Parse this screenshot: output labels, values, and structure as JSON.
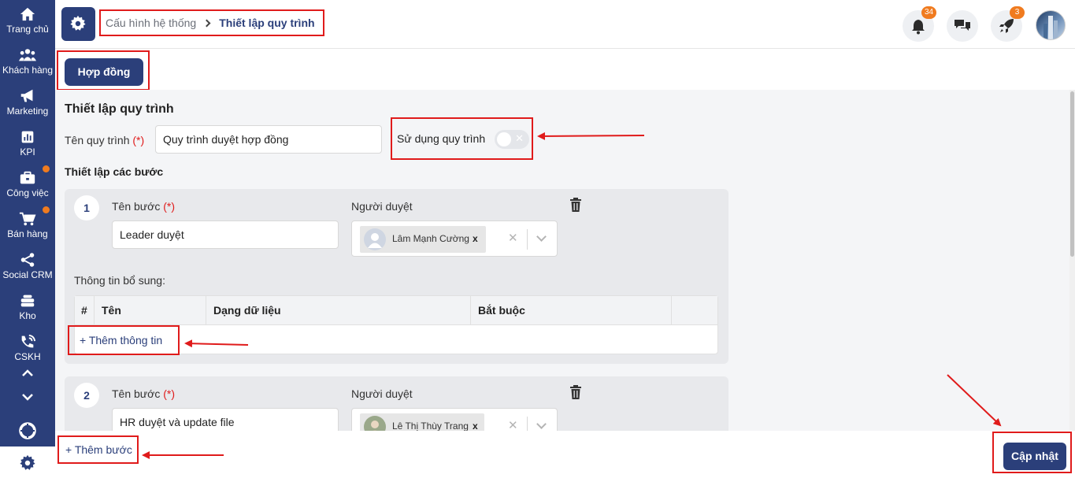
{
  "sidebar": {
    "items": [
      {
        "label": "Trang chủ",
        "icon": "home-icon",
        "dot": false
      },
      {
        "label": "Khách hàng",
        "icon": "users-icon",
        "dot": false
      },
      {
        "label": "Marketing",
        "icon": "megaphone-icon",
        "dot": false
      },
      {
        "label": "KPI",
        "icon": "bar-chart-icon",
        "dot": false
      },
      {
        "label": "Công việc",
        "icon": "briefcase-icon",
        "dot": true
      },
      {
        "label": "Bán hàng",
        "icon": "cart-icon",
        "dot": true
      },
      {
        "label": "Social CRM",
        "icon": "share-icon",
        "dot": false
      },
      {
        "label": "Kho",
        "icon": "warehouse-icon",
        "dot": false
      },
      {
        "label": "CSKH",
        "icon": "phone-icon",
        "dot": false
      }
    ],
    "accent": "#2b3f7a",
    "dot_color": "#f07b1f"
  },
  "header": {
    "breadcrumb": [
      "Cấu hình hệ thống",
      "Thiết lập quy trình"
    ],
    "notifications_count": "34",
    "rocket_count": "3"
  },
  "tabs": [
    {
      "label": "Hợp đồng",
      "active": true
    }
  ],
  "form": {
    "title": "Thiết lập quy trình",
    "name_label": "Tên quy trình",
    "required_mark": "(*)",
    "name_value": "Quy trình duyệt hợp đồng",
    "use_label": "Sử dụng quy trình",
    "use_enabled": false,
    "steps_title": "Thiết lập các bước"
  },
  "steps": [
    {
      "number": "1",
      "name_label": "Tên bước",
      "name_value": "Leader duyệt",
      "approver_label": "Người duyệt",
      "approver": "Lâm Mạnh Cường",
      "extra_label": "Thông tin bổ sung:",
      "table_headers": [
        "#",
        "Tên",
        "Dạng dữ liệu",
        "Bắt buộc"
      ],
      "add_info": "+ Thêm thông tin"
    },
    {
      "number": "2",
      "name_label": "Tên bước",
      "name_value": "HR duyệt và update file",
      "approver_label": "Người duyệt",
      "approver": "Lê Thị Thùy Trang"
    }
  ],
  "footer": {
    "add_step": "+ Thêm bước",
    "save": "Cập nhật"
  },
  "highlight_color": "#e01b1b"
}
